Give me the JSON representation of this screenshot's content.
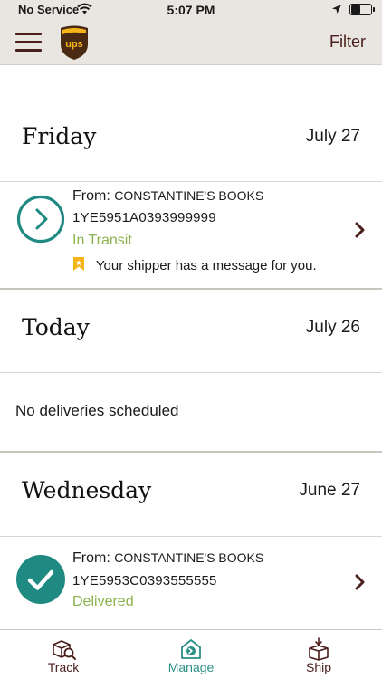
{
  "status_bar": {
    "carrier": "No Service",
    "time": "5:07 PM"
  },
  "header": {
    "logo_text": "ups",
    "filter_label": "Filter"
  },
  "sections": [
    {
      "day": "Friday",
      "date": "July 27",
      "shipment": {
        "from_label": "From:",
        "shipper": "CONSTANTINE'S BOOKS",
        "tracking_number": "1YE5951A0393999999",
        "status": "In Transit",
        "message": "Your shipper has a message for you."
      }
    },
    {
      "day": "Today",
      "date": "July 26",
      "empty_message": "No deliveries scheduled"
    },
    {
      "day": "Wednesday",
      "date": "June 27",
      "shipment": {
        "from_label": "From:",
        "shipper": "CONSTANTINE'S BOOKS",
        "tracking_number": "1YE5953C0393555555",
        "status": "Delivered"
      }
    }
  ],
  "tabs": [
    {
      "label": "Track",
      "icon": "track-icon",
      "active": false
    },
    {
      "label": "Manage",
      "icon": "manage-icon",
      "active": true
    },
    {
      "label": "Ship",
      "icon": "ship-icon",
      "active": false
    }
  ],
  "colors": {
    "header_bg": "#e9e6e1",
    "brand_brown": "#4a1e1a",
    "teal": "#2a8f86",
    "status_green": "#8bb24c",
    "ups_gold": "#f5b51a"
  }
}
